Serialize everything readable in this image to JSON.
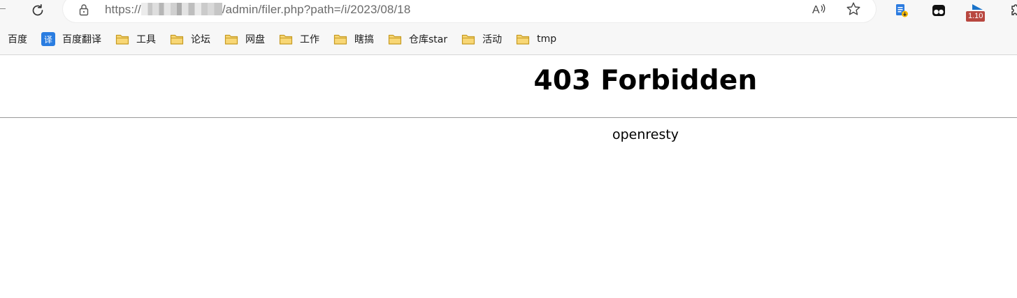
{
  "browser": {
    "url_prefix": "https://",
    "url_suffix": "/admin/filer.php?path=/i/2023/08/18",
    "read_aloud_label": "Aᴬ",
    "extension_badge": "1.10",
    "bookmarks": [
      {
        "label": "百度",
        "icon": "none"
      },
      {
        "label": "百度翻译",
        "icon": "translate-icon",
        "icon_text": "译"
      },
      {
        "label": "工具",
        "icon": "folder-icon"
      },
      {
        "label": "论坛",
        "icon": "folder-icon"
      },
      {
        "label": "网盘",
        "icon": "folder-icon"
      },
      {
        "label": "工作",
        "icon": "folder-icon"
      },
      {
        "label": "瞎搞",
        "icon": "folder-icon"
      },
      {
        "label": "仓库star",
        "icon": "folder-icon"
      },
      {
        "label": "活动",
        "icon": "folder-icon"
      },
      {
        "label": "tmp",
        "icon": "folder-icon"
      }
    ]
  },
  "page": {
    "title": "403 Forbidden",
    "server": "openresty"
  },
  "colors": {
    "folder_fill": "#f8d775",
    "folder_stroke": "#c69a22",
    "translate_bg": "#2a7de1",
    "badge_bg": "#b8473f"
  }
}
